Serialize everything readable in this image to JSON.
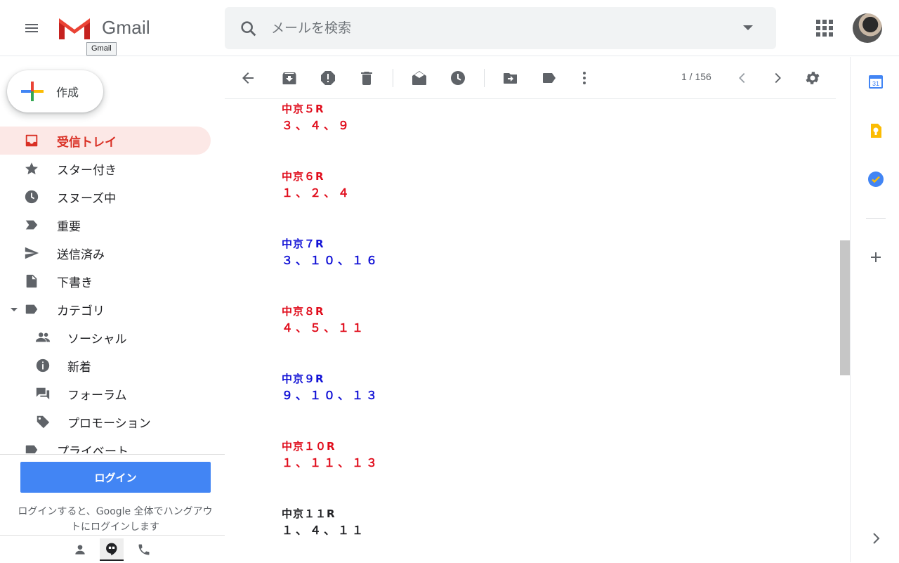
{
  "app": {
    "logo_text": "Gmail",
    "logo_tooltip": "Gmail"
  },
  "search": {
    "placeholder": "メールを検索"
  },
  "compose": {
    "label": "作成"
  },
  "nav": {
    "items": [
      {
        "label": "受信トレイ",
        "icon": "inbox-icon",
        "active": true
      },
      {
        "label": "スター付き",
        "icon": "star-icon"
      },
      {
        "label": "スヌーズ中",
        "icon": "clock-icon"
      },
      {
        "label": "重要",
        "icon": "important-icon"
      },
      {
        "label": "送信済み",
        "icon": "send-icon"
      },
      {
        "label": "下書き",
        "icon": "draft-icon"
      },
      {
        "label": "カテゴリ",
        "icon": "label-icon",
        "expanded": true
      },
      {
        "label": "ソーシャル",
        "icon": "people-icon",
        "sub": true
      },
      {
        "label": "新着",
        "icon": "info-icon",
        "sub": true
      },
      {
        "label": "フォーラム",
        "icon": "forum-icon",
        "sub": true
      },
      {
        "label": "プロモーション",
        "icon": "tag-icon",
        "sub": true
      },
      {
        "label": "プライベート",
        "icon": "label-icon"
      }
    ]
  },
  "hangouts": {
    "login_label": "ログイン",
    "note": "ログインすると、Google 全体でハングアウトにログインします"
  },
  "toolbar": {
    "page_count": "1 / 156"
  },
  "message": {
    "races": [
      {
        "title": "中京５R",
        "nums": "３、４、９",
        "color": "#e00d1c"
      },
      {
        "title": "中京６R",
        "nums": "１、２、４",
        "color": "#e00d1c"
      },
      {
        "title": "中京７R",
        "nums": "３、１０、１６",
        "color": "#1212d6"
      },
      {
        "title": "中京８R",
        "nums": "４、５、１１",
        "color": "#e00d1c"
      },
      {
        "title": "中京９R",
        "nums": "９、１０、１３",
        "color": "#1212d6"
      },
      {
        "title": "中京１０R",
        "nums": "１、１１、１３",
        "color": "#e00d1c"
      },
      {
        "title": "中京１１R",
        "nums": "１、４、１１",
        "color": "#202124"
      }
    ]
  },
  "colors": {
    "accent_red": "#d93025",
    "active_bg": "#fce8e6",
    "login_blue": "#4285f4"
  }
}
